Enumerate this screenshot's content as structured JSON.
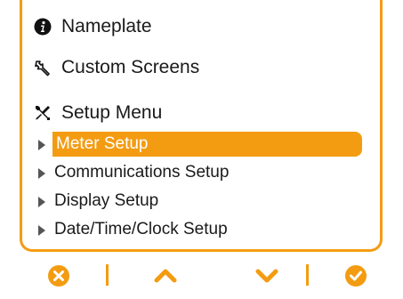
{
  "menu": {
    "items": [
      {
        "label": "Nameplate",
        "icon": "info-icon"
      },
      {
        "label": "Custom Screens",
        "icon": "wrench-icon"
      },
      {
        "label": "Setup Menu",
        "icon": "tools-icon"
      }
    ],
    "submenu": [
      {
        "label": "Meter Setup",
        "selected": true
      },
      {
        "label": "Communications Setup",
        "selected": false
      },
      {
        "label": "Display Setup",
        "selected": false
      },
      {
        "label": "Date/Time/Clock Setup",
        "selected": false
      }
    ]
  },
  "softkeys": [
    {
      "icon": "cancel-icon"
    },
    {
      "icon": "up-arrow-icon"
    },
    {
      "icon": "down-arrow-icon"
    },
    {
      "icon": "check-icon"
    }
  ],
  "colors": {
    "accent": "#f39c12",
    "text": "#1a1a1a",
    "selected_text": "#ffffff"
  }
}
